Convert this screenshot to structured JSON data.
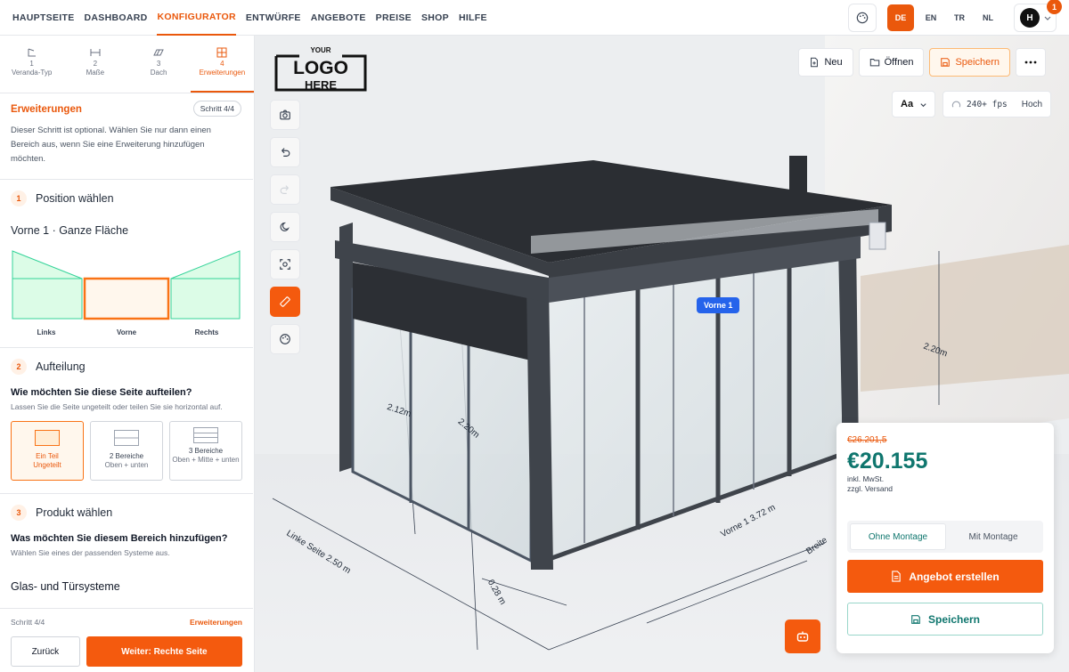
{
  "nav": {
    "items": [
      "HAUPTSEITE",
      "DASHBOARD",
      "KONFIGURATOR",
      "ENTWÜRFE",
      "ANGEBOTE",
      "PREISE",
      "SHOP",
      "HILFE"
    ],
    "active": "KONFIGURATOR"
  },
  "topright": {
    "languages": [
      "DE",
      "EN",
      "TR",
      "NL"
    ],
    "active_language": "DE",
    "avatar_initial": "H",
    "notification_count": "1"
  },
  "steps": [
    {
      "num": "1",
      "label": "Veranda-Typ",
      "icon": "veranda-icon"
    },
    {
      "num": "2",
      "label": "Maße",
      "icon": "dimensions-icon"
    },
    {
      "num": "3",
      "label": "Dach",
      "icon": "roof-icon"
    },
    {
      "num": "4",
      "label": "Erweiterungen",
      "icon": "extensions-icon"
    }
  ],
  "section": {
    "title": "Erweiterungen",
    "badge": "Schritt 4/4",
    "description": "Dieser Schritt ist optional. Wählen Sie nur dann einen Bereich aus, wenn Sie eine Erweiterung hinzufügen möchten."
  },
  "position": {
    "num": "1",
    "title": "Position wählen",
    "selected": "Vorne 1 · Ganze Fläche",
    "labels": [
      "Links",
      "Vorne",
      "Rechts"
    ]
  },
  "aufteilung": {
    "num": "2",
    "title": "Aufteilung",
    "question": "Wie möchten Sie diese Seite aufteilen?",
    "hint": "Lassen Sie die Seite ungeteilt oder teilen Sie sie horizontal auf.",
    "options": [
      {
        "title": "Ein Teil",
        "sub": "Ungeteilt"
      },
      {
        "title": "2 Bereiche",
        "sub": "Oben + unten"
      },
      {
        "title": "3 Bereiche",
        "sub": "Oben + Mitte + unten"
      }
    ]
  },
  "produkt": {
    "num": "3",
    "title": "Produkt wählen",
    "question": "Was möchten Sie diesem Bereich hinzufügen?",
    "hint": "Wählen Sie eines der passenden Systeme aus.",
    "group": "Glas- und Türsysteme"
  },
  "footer": {
    "step": "Schritt 4/4",
    "current": "Erweiterungen",
    "back": "Zurück",
    "next": "Weiter: Rechte Seite"
  },
  "viewport": {
    "logo_lines": [
      "YOUR",
      "LOGO",
      "HERE"
    ],
    "buttons": {
      "neu": "Neu",
      "open": "Öffnen",
      "save": "Speichern"
    },
    "font_btn": "Aa",
    "fps": "240+ fps",
    "quality": "Hoch",
    "tag": "Vorne 1",
    "dimensions": {
      "left_side": "Linke Seite  2.50 m",
      "front": "Vorne 1  3.72 m",
      "width": "Breite",
      "height_right": "2.20m",
      "height_a": "2.12m",
      "height_b": "2.20m",
      "gap": "0.28 m"
    }
  },
  "price": {
    "old": "€26.201,5",
    "new": "€20.155",
    "note1": "inkl. MwSt.",
    "note2": "zzgl. Versand",
    "options": [
      "Ohne Montage",
      "Mit Montage"
    ],
    "active_option": "Ohne Montage",
    "quote_btn": "Angebot erstellen",
    "save_btn": "Speichern"
  },
  "colors": {
    "accent": "#f45a0e",
    "teal": "#0f766e",
    "blue": "#2563eb"
  }
}
